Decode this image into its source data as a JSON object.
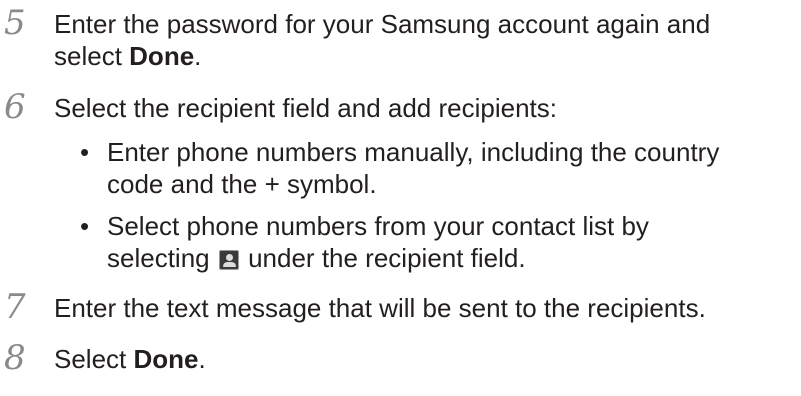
{
  "steps": [
    {
      "number": "5",
      "line1": "Enter the password for your Samsung account again and",
      "line2_prefix": "select ",
      "line2_bold": "Done",
      "line2_suffix": "."
    },
    {
      "number": "6",
      "text": "Select the recipient field and add recipients:",
      "bullets": [
        {
          "bullet": "•",
          "line1": "Enter phone numbers manually, including the country",
          "line2": "code and the + symbol."
        },
        {
          "bullet": "•",
          "line1": "Select phone numbers from your contact list by",
          "line2_prefix": "selecting",
          "icon": "contacts-icon",
          "line2_suffix": "under the recipient field."
        }
      ]
    },
    {
      "number": "7",
      "text": "Enter the text message that will be sent to the recipients."
    },
    {
      "number": "8",
      "prefix": "Select ",
      "bold": "Done",
      "suffix": "."
    }
  ]
}
